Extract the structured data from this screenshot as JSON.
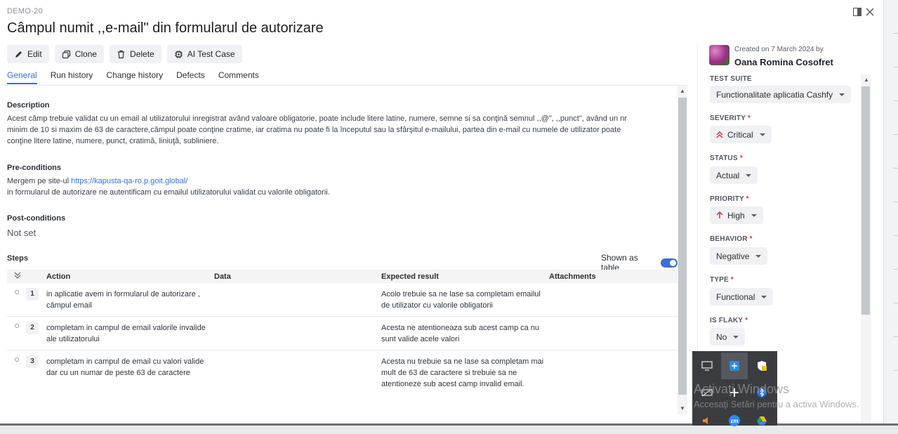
{
  "header": {
    "key": "DEMO-20",
    "title": "Câmpul numit ,,e-mail\" din formularul de autorizare"
  },
  "toolbar": {
    "edit": "Edit",
    "clone": "Clone",
    "delete": "Delete",
    "ai": "AI Test Case"
  },
  "tabs": [
    "General",
    "Run history",
    "Change history",
    "Defects",
    "Comments"
  ],
  "description": {
    "heading": "Description",
    "lines": [
      "Acest câmp trebuie validat cu un email al utilizatorului inregistrat având valoare obligatorie, poate include litere latine, numere, semne si sa conţină semnul ,,@\", ,,punct\", având un nr",
      "minim de 10 si maxim de 63 de caractere,câmpul poate conţine cratime, iar cratima nu poate fi la începutul sau la sfârşitul e-mailului, partea din e-mail cu numele de utilizator poate",
      "conţine litere latine, numere, punct, cratimă, liniuţă, subliniere."
    ]
  },
  "preconditions": {
    "heading": "Pre-conditions",
    "line1_prefix": "Mergem pe site-ul ",
    "link": "https://kapusta-qa-ro.p.goit.global/",
    "line2": "in formularul de autorizare ne autentificam cu emailul utilizatorului validat cu valorile obligatorii."
  },
  "postconditions": {
    "heading": "Post-conditions",
    "value": "Not set"
  },
  "steps": {
    "heading": "Steps",
    "shown_as_table": "Shown as table",
    "columns": {
      "action": "Action",
      "data": "Data",
      "expected": "Expected result",
      "attachments": "Attachments"
    },
    "rows": [
      {
        "num": "1",
        "action": "in aplicatie avem in formularul de autorizare , câmpul email",
        "expected": "Acolo trebuie sa ne lase sa completam emailul de utilizator cu valorile obligatorii"
      },
      {
        "num": "2",
        "action": "completam in campul de email valorile invalide ale utilizatorului",
        "expected": "Acesta ne atentioneaza sub acest camp ca nu sunt valide acele valori"
      },
      {
        "num": "3",
        "action": "completam in campul de email cu valori valide dar cu un numar de peste 63 de caractere",
        "expected": "Acesta nu trebuie sa ne lase sa completam mai mult de 63 de caractere si trebuie sa ne atentioneze sub acest camp invalid email."
      }
    ]
  },
  "meta": {
    "created": "Created on 7 March 2024 by",
    "author": "Oana Romina Cosofret"
  },
  "fields": {
    "test_suite": {
      "label": "TEST SUITE",
      "value": "Functionalitate aplicatia Cashfy"
    },
    "severity": {
      "label": "SEVERITY",
      "value": "Critical"
    },
    "status": {
      "label": "STATUS",
      "value": "Actual"
    },
    "priority": {
      "label": "PRIORITY",
      "value": "High"
    },
    "behavior": {
      "label": "BEHAVIOR",
      "value": "Negative"
    },
    "type": {
      "label": "TYPE",
      "value": "Functional"
    },
    "is_flaky": {
      "label": "IS FLAKY",
      "value": "No"
    },
    "required_mark": "*"
  },
  "watermark": {
    "line1": "Activaţi Windows",
    "line2": "Accesaţi Setări pentru a activa Windows."
  },
  "tray": {
    "zoom_label": "zm"
  },
  "colors": {
    "accent": "#3c6fd0",
    "critical": "#d0353f",
    "tray_bg": "#3a3c40"
  }
}
